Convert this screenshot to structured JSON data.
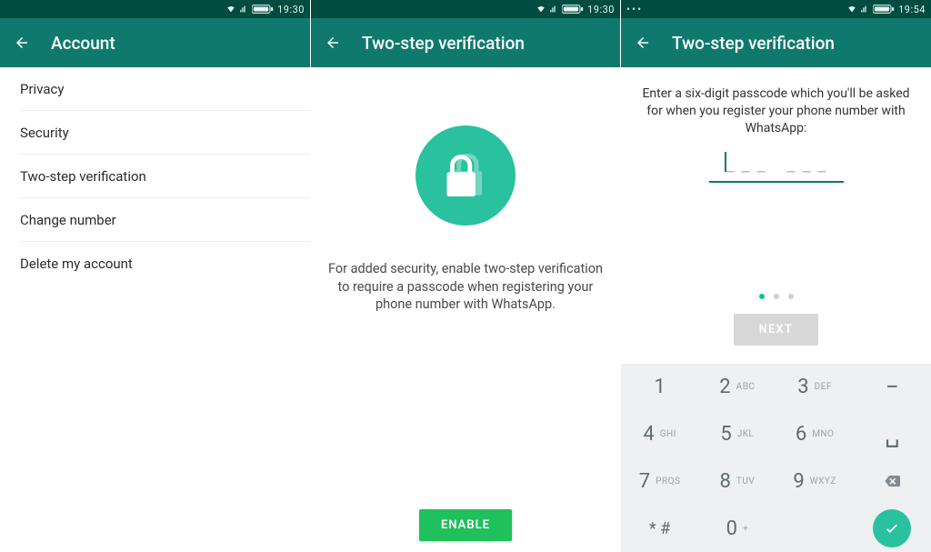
{
  "colors": {
    "status_bg": "#004c40",
    "header_bg": "#0f796e",
    "accent": "#29c19e",
    "accent_btn": "#20c05c"
  },
  "pane0": {
    "status_time": "19:30",
    "title": "Account",
    "items": [
      "Privacy",
      "Security",
      "Two-step verification",
      "Change number",
      "Delete my account"
    ]
  },
  "pane1": {
    "status_time": "19:30",
    "title": "Two-step verification",
    "description": "For added security, enable two-step verification to require a passcode when registering your phone number with WhatsApp.",
    "enable_label": "ENABLE"
  },
  "pane2": {
    "status_time": "19:54",
    "title": "Two-step verification",
    "instruction": "Enter a six-digit passcode which you'll be asked for when you register your phone number with WhatsApp:",
    "next_label": "NEXT",
    "page_index": 0,
    "page_count": 3,
    "keypad": [
      {
        "digit": "1",
        "label": ""
      },
      {
        "digit": "2",
        "label": "ABC"
      },
      {
        "digit": "3",
        "label": "DEF"
      },
      {
        "digit": "4",
        "label": "GHI"
      },
      {
        "digit": "5",
        "label": "JKL"
      },
      {
        "digit": "6",
        "label": "MNO"
      },
      {
        "digit": "7",
        "label": "PRQS"
      },
      {
        "digit": "8",
        "label": "TUV"
      },
      {
        "digit": "9",
        "label": "WXYZ"
      },
      {
        "digit": "* #",
        "label": ""
      },
      {
        "digit": "0",
        "label": "+"
      }
    ],
    "minus_key": "−",
    "underscore_key": "␣"
  }
}
